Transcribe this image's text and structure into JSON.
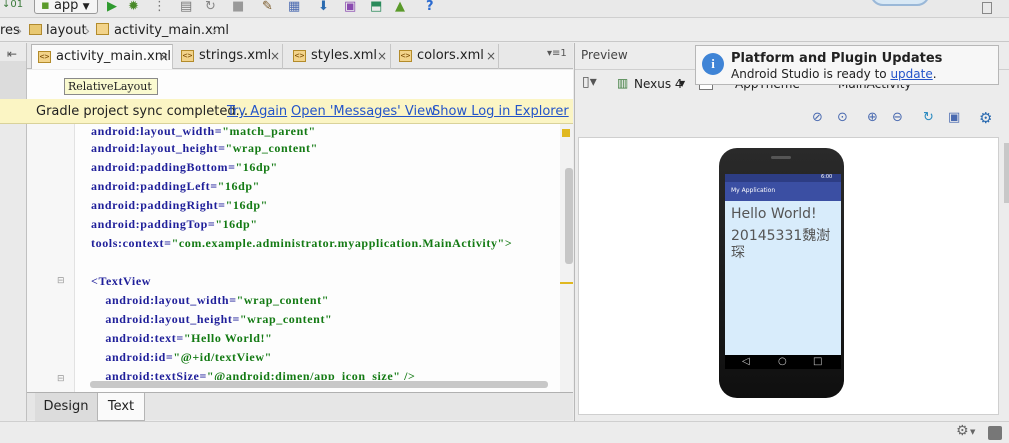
{
  "toolbar": {
    "left_fragment": "↓01",
    "app_selector": "app",
    "help_icon": "?"
  },
  "breadcrumb": {
    "partial": "res",
    "items": [
      "layout",
      "activity_main.xml"
    ]
  },
  "editor_tabs": [
    {
      "label": "activity_main.xml",
      "active": true
    },
    {
      "label": "strings.xml",
      "active": false
    },
    {
      "label": "styles.xml",
      "active": false
    },
    {
      "label": "colors.xml",
      "active": false
    }
  ],
  "tabs_overflow": "▾≡1",
  "tooltip": "RelativeLayout",
  "sync_bar": {
    "message": "Gradle project sync completed...",
    "try_again": "Try Again",
    "open_messages": "Open 'Messages' View",
    "show_log": "Show Log in Explorer"
  },
  "code_lines": [
    {
      "attr": "android:layout_width=",
      "val": "\"match_parent\""
    },
    {
      "attr": "android:layout_height=",
      "val": "\"wrap_content\""
    },
    {
      "attr": "android:paddingBottom=",
      "val": "\"16dp\""
    },
    {
      "attr": "android:paddingLeft=",
      "val": "\"16dp\""
    },
    {
      "attr": "android:paddingRight=",
      "val": "\"16dp\""
    },
    {
      "attr": "android:paddingTop=",
      "val": "\"16dp\""
    },
    {
      "attr": "tools:context=",
      "val": "\"com.example.administrator.myapplication.MainActivity\">"
    },
    {
      "attr": "",
      "val": ""
    },
    {
      "attr": "<TextView",
      "val": ""
    },
    {
      "attr": "    android:layout_width=",
      "val": "\"wrap_content\""
    },
    {
      "attr": "    android:layout_height=",
      "val": "\"wrap_content\""
    },
    {
      "attr": "    android:text=",
      "val": "\"Hello World!\""
    },
    {
      "attr": "    android:id=",
      "val": "\"@+id/textView\""
    },
    {
      "attr": "    android:textSize=",
      "val": "\"@android:dimen/app_icon_size\" />"
    }
  ],
  "bottom_tabs": {
    "design": "Design",
    "text": "Text"
  },
  "preview": {
    "title": "Preview",
    "device": "Nexus 4",
    "theme": "AppTheme",
    "activity": "MainActivity",
    "app_bar_title": "My Application",
    "status_time": "6:00",
    "text_hello": "Hello World!",
    "text_second": "20145331魏澍琛"
  },
  "notification": {
    "title": "Platform and Plugin Updates",
    "body": "Android Studio is ready to ",
    "link": "update",
    "suffix": "."
  },
  "colors": {
    "accent": "#2354c9",
    "sync_bg": "#fbf5c4",
    "code_attr": "#1f1f9a",
    "code_value": "#137a13",
    "app_bar": "#3b4fa3",
    "screen_bg": "#d8ecfb"
  }
}
